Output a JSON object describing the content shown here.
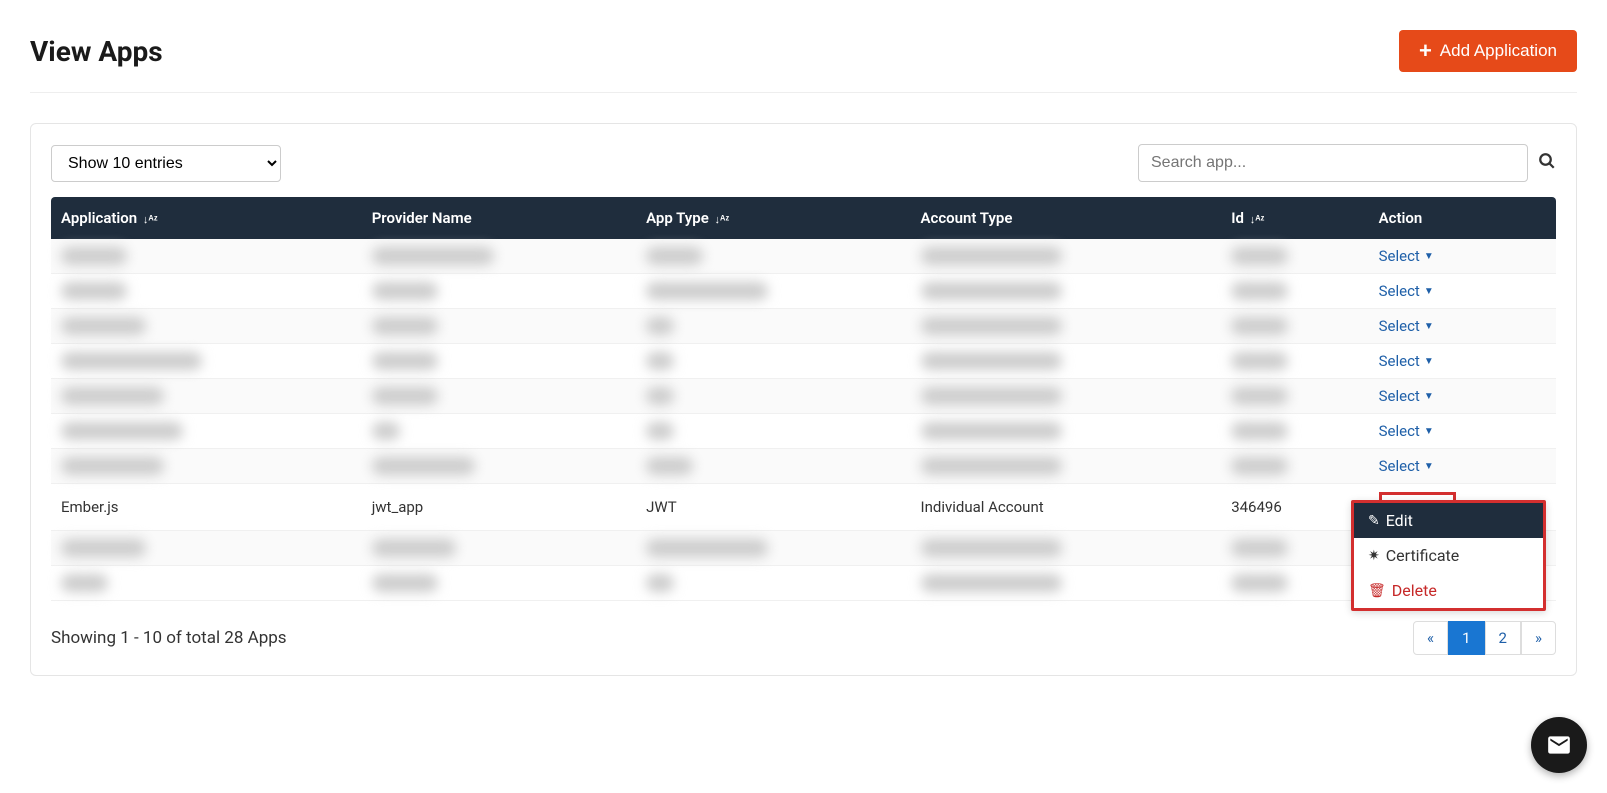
{
  "header": {
    "title": "View Apps",
    "add_button": "Add Application"
  },
  "controls": {
    "entries_label": "Show 10 entries",
    "search_placeholder": "Search app..."
  },
  "table": {
    "columns": {
      "application": "Application",
      "provider": "Provider Name",
      "app_type": "App Type",
      "account_type": "Account Type",
      "id": "Id",
      "action": "Action"
    },
    "select_label": "Select",
    "visible_row": {
      "application": "Ember.js",
      "provider": "jwt_app",
      "app_type": "JWT",
      "account_type": "Individual Account",
      "id": "346496"
    }
  },
  "dropdown": {
    "edit": "Edit",
    "certificate": "Certificate",
    "delete": "Delete"
  },
  "footer": {
    "showing": "Showing 1 - 10 of total 28 Apps",
    "pages": {
      "prev": "«",
      "p1": "1",
      "p2": "2",
      "next": "»"
    }
  }
}
